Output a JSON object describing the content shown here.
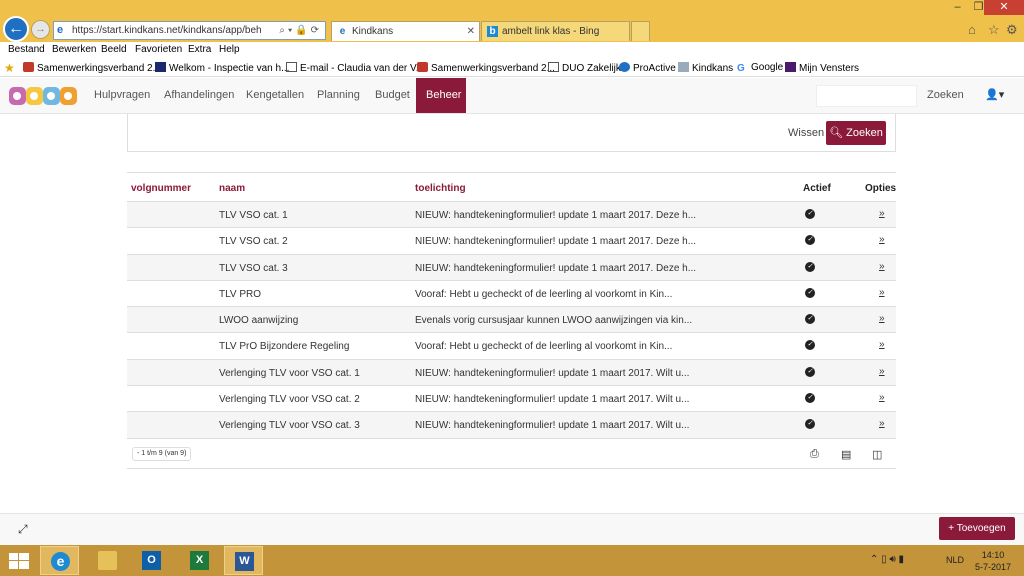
{
  "browser": {
    "url": "https://start.kindkans.net/kindkans/app/beheer/lijs",
    "url_host": "start.kindkans.net",
    "tabs": [
      {
        "label": "Kindkans"
      },
      {
        "label": "ambelt link klas - Bing"
      }
    ],
    "menu": [
      "Bestand",
      "Bewerken",
      "Beeld",
      "Favorieten",
      "Extra",
      "Help"
    ],
    "favorites": [
      "Samenwerkingsverband 2...",
      "Welkom - Inspectie van h...",
      "E-mail - Claudia van der V...",
      "Samenwerkingsverband 2...",
      "DUO Zakelijk",
      "ProActive",
      "Kindkans",
      "Google",
      "Mijn Vensters"
    ]
  },
  "app": {
    "nav": [
      "Hulpvragen",
      "Afhandelingen",
      "Kengetallen",
      "Planning",
      "Budget",
      "Beheer"
    ],
    "active_nav": "Beheer",
    "search_link": "Zoeken",
    "filter": {
      "clear_label": "Wissen",
      "search_label": "Zoeken"
    },
    "table": {
      "headers": {
        "volgnummer": "volgnummer",
        "naam": "naam",
        "toelichting": "toelichting",
        "actief": "Actief",
        "opties": "Opties"
      },
      "rows": [
        {
          "naam": "TLV VSO cat. 1",
          "toelichting": "NIEUW: handtekeningformulier! update 1 maart 2017. Deze h...",
          "option": "»"
        },
        {
          "naam": "TLV VSO cat. 2",
          "toelichting": "NIEUW: handtekeningformulier! update 1 maart 2017. Deze h...",
          "option": "»"
        },
        {
          "naam": "TLV VSO cat. 3",
          "toelichting": "NIEUW: handtekeningformulier! update 1 maart 2017. Deze h...",
          "option": "»"
        },
        {
          "naam": "TLV PRO",
          "toelichting": "Vooraf: Hebt u gecheckt of de leerling al voorkomt in Kin...",
          "option": "»"
        },
        {
          "naam": "LWOO aanwijzing",
          "toelichting": "Evenals vorig cursusjaar kunnen LWOO aanwijzingen via kin...",
          "option": "»"
        },
        {
          "naam": "TLV PrO Bijzondere Regeling",
          "toelichting": "Vooraf: Hebt u gecheckt of de leerling al voorkomt in Kin...",
          "option": "»"
        },
        {
          "naam": "Verlenging TLV voor VSO cat. 1",
          "toelichting": "NIEUW: handtekeningformulier! update 1 maart 2017. Wilt u...",
          "option": "»"
        },
        {
          "naam": "Verlenging TLV voor VSO cat. 2",
          "toelichting": "NIEUW: handtekeningformulier! update 1 maart 2017. Wilt u...",
          "option": "»"
        },
        {
          "naam": "Verlenging TLV voor VSO cat. 3",
          "toelichting": "NIEUW: handtekeningformulier! update 1 maart 2017. Wilt u...",
          "option": "»"
        }
      ],
      "pager": "- 1 t/m 9 (van 9)"
    },
    "add_button": "Toevoegen"
  },
  "taskbar": {
    "language": "NLD",
    "time": "14:10",
    "date": "5-7-2017"
  },
  "colors": {
    "brand": "#8b1a3a",
    "titlebar": "#f0c14a",
    "taskbar": "#c4943a"
  }
}
